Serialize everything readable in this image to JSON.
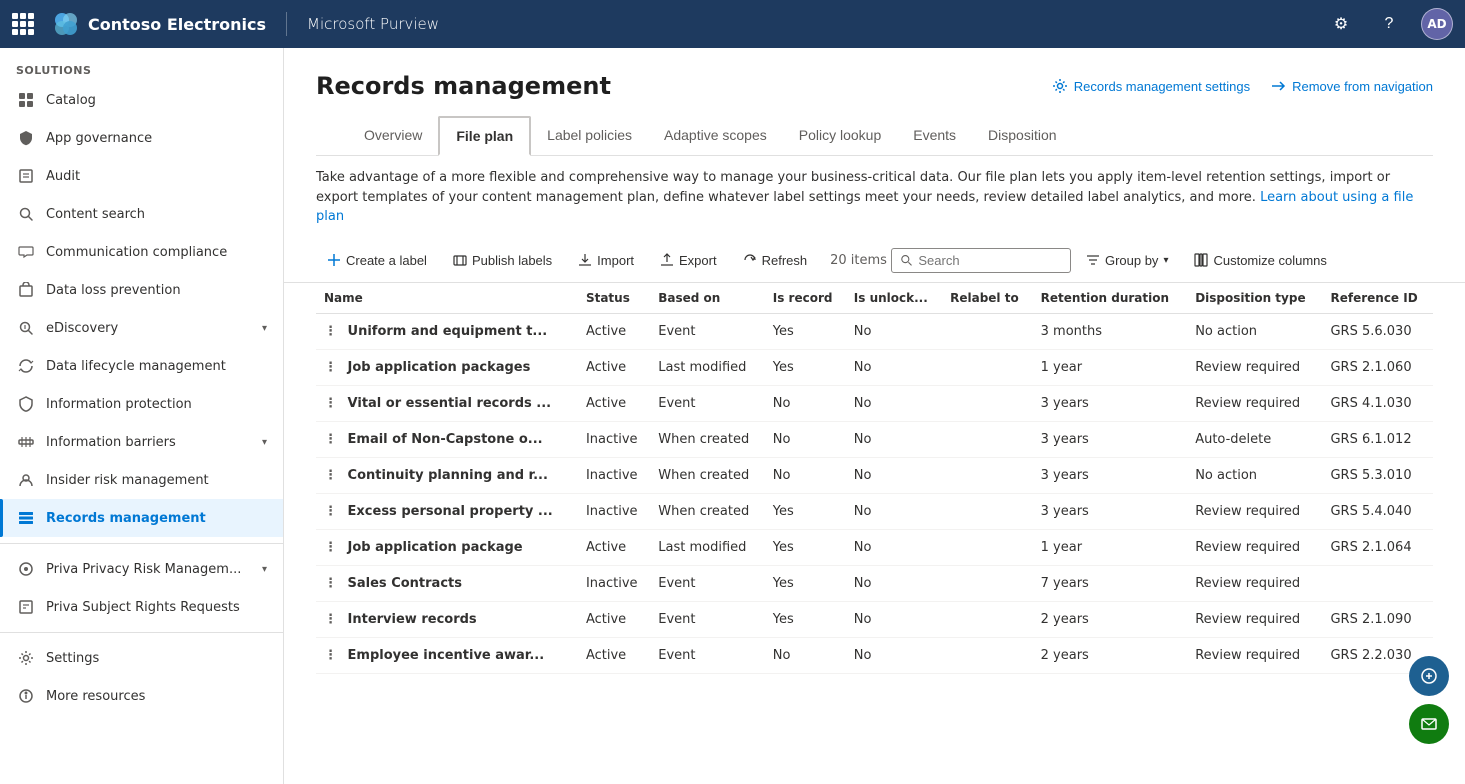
{
  "topnav": {
    "company": "Contoso Electronics",
    "app": "Microsoft Purview",
    "avatar_initials": "AD",
    "settings_label": "Settings",
    "help_label": "Help"
  },
  "sidebar": {
    "section_label": "Solutions",
    "items": [
      {
        "id": "catalog",
        "label": "Catalog",
        "icon": "catalog"
      },
      {
        "id": "app-governance",
        "label": "App governance",
        "icon": "app-governance"
      },
      {
        "id": "audit",
        "label": "Audit",
        "icon": "audit"
      },
      {
        "id": "content-search",
        "label": "Content search",
        "icon": "content-search"
      },
      {
        "id": "communication-compliance",
        "label": "Communication compliance",
        "icon": "communication-compliance"
      },
      {
        "id": "data-loss-prevention",
        "label": "Data loss prevention",
        "icon": "data-loss-prevention"
      },
      {
        "id": "ediscovery",
        "label": "eDiscovery",
        "icon": "ediscovery",
        "has_chevron": true
      },
      {
        "id": "data-lifecycle-management",
        "label": "Data lifecycle management",
        "icon": "data-lifecycle"
      },
      {
        "id": "information-protection",
        "label": "Information protection",
        "icon": "information-protection"
      },
      {
        "id": "information-barriers",
        "label": "Information barriers",
        "icon": "information-barriers",
        "has_chevron": true
      },
      {
        "id": "insider-risk-management",
        "label": "Insider risk management",
        "icon": "insider-risk"
      },
      {
        "id": "records-management",
        "label": "Records management",
        "icon": "records-management",
        "active": true
      }
    ],
    "bottom_items": [
      {
        "id": "priva-privacy",
        "label": "Priva Privacy Risk Managem...",
        "icon": "priva-privacy",
        "has_chevron": true
      },
      {
        "id": "priva-subject",
        "label": "Priva Subject Rights Requests",
        "icon": "priva-subject"
      }
    ],
    "settings_item": {
      "label": "Settings",
      "icon": "settings"
    },
    "more_resources": {
      "label": "More resources",
      "icon": "more-resources"
    }
  },
  "page": {
    "title": "Records management",
    "settings_btn": "Records management settings",
    "remove_nav_btn": "Remove from navigation",
    "description": "Take advantage of a more flexible and comprehensive way to manage your business-critical data. Our file plan lets you apply item-level retention settings, import or export templates of your content management plan, define whatever label settings meet your needs, review detailed label analytics, and more.",
    "learn_more_link": "Learn about using a file plan"
  },
  "tabs": [
    {
      "id": "overview",
      "label": "Overview",
      "active": false
    },
    {
      "id": "file-plan",
      "label": "File plan",
      "active": true
    },
    {
      "id": "label-policies",
      "label": "Label policies",
      "active": false
    },
    {
      "id": "adaptive-scopes",
      "label": "Adaptive scopes",
      "active": false
    },
    {
      "id": "policy-lookup",
      "label": "Policy lookup",
      "active": false
    },
    {
      "id": "events",
      "label": "Events",
      "active": false
    },
    {
      "id": "disposition",
      "label": "Disposition",
      "active": false
    }
  ],
  "toolbar": {
    "create_label": "Create a label",
    "publish_labels": "Publish labels",
    "import": "Import",
    "export": "Export",
    "refresh": "Refresh",
    "item_count": "20 items",
    "search_placeholder": "Search",
    "group_by": "Group by",
    "customize_columns": "Customize columns"
  },
  "table": {
    "columns": [
      {
        "id": "name",
        "label": "Name"
      },
      {
        "id": "status",
        "label": "Status"
      },
      {
        "id": "based-on",
        "label": "Based on"
      },
      {
        "id": "is-record",
        "label": "Is record"
      },
      {
        "id": "is-unlock",
        "label": "Is unlock..."
      },
      {
        "id": "relabel-to",
        "label": "Relabel to"
      },
      {
        "id": "retention-duration",
        "label": "Retention duration"
      },
      {
        "id": "disposition-type",
        "label": "Disposition type"
      },
      {
        "id": "reference-id",
        "label": "Reference ID"
      }
    ],
    "rows": [
      {
        "name": "Uniform and equipment t...",
        "status": "Active",
        "based_on": "Event",
        "is_record": "Yes",
        "is_unlock": "No",
        "relabel_to": "",
        "retention_duration": "3 months",
        "disposition_type": "No action",
        "reference_id": "GRS 5.6.030"
      },
      {
        "name": "Job application packages",
        "status": "Active",
        "based_on": "Last modified",
        "is_record": "Yes",
        "is_unlock": "No",
        "relabel_to": "",
        "retention_duration": "1 year",
        "disposition_type": "Review required",
        "reference_id": "GRS 2.1.060"
      },
      {
        "name": "Vital or essential records ...",
        "status": "Active",
        "based_on": "Event",
        "is_record": "No",
        "is_unlock": "No",
        "relabel_to": "",
        "retention_duration": "3 years",
        "disposition_type": "Review required",
        "reference_id": "GRS 4.1.030"
      },
      {
        "name": "Email of Non-Capstone o...",
        "status": "Inactive",
        "based_on": "When created",
        "is_record": "No",
        "is_unlock": "No",
        "relabel_to": "",
        "retention_duration": "3 years",
        "disposition_type": "Auto-delete",
        "reference_id": "GRS 6.1.012"
      },
      {
        "name": "Continuity planning and r...",
        "status": "Inactive",
        "based_on": "When created",
        "is_record": "No",
        "is_unlock": "No",
        "relabel_to": "",
        "retention_duration": "3 years",
        "disposition_type": "No action",
        "reference_id": "GRS 5.3.010"
      },
      {
        "name": "Excess personal property ...",
        "status": "Inactive",
        "based_on": "When created",
        "is_record": "Yes",
        "is_unlock": "No",
        "relabel_to": "",
        "retention_duration": "3 years",
        "disposition_type": "Review required",
        "reference_id": "GRS 5.4.040"
      },
      {
        "name": "Job application package",
        "status": "Active",
        "based_on": "Last modified",
        "is_record": "Yes",
        "is_unlock": "No",
        "relabel_to": "",
        "retention_duration": "1 year",
        "disposition_type": "Review required",
        "reference_id": "GRS 2.1.064"
      },
      {
        "name": "Sales Contracts",
        "status": "Inactive",
        "based_on": "Event",
        "is_record": "Yes",
        "is_unlock": "No",
        "relabel_to": "",
        "retention_duration": "7 years",
        "disposition_type": "Review required",
        "reference_id": ""
      },
      {
        "name": "Interview records",
        "status": "Active",
        "based_on": "Event",
        "is_record": "Yes",
        "is_unlock": "No",
        "relabel_to": "",
        "retention_duration": "2 years",
        "disposition_type": "Review required",
        "reference_id": "GRS 2.1.090"
      },
      {
        "name": "Employee incentive awar...",
        "status": "Active",
        "based_on": "Event",
        "is_record": "No",
        "is_unlock": "No",
        "relabel_to": "",
        "retention_duration": "2 years",
        "disposition_type": "Review required",
        "reference_id": "GRS 2.2.030"
      }
    ]
  }
}
